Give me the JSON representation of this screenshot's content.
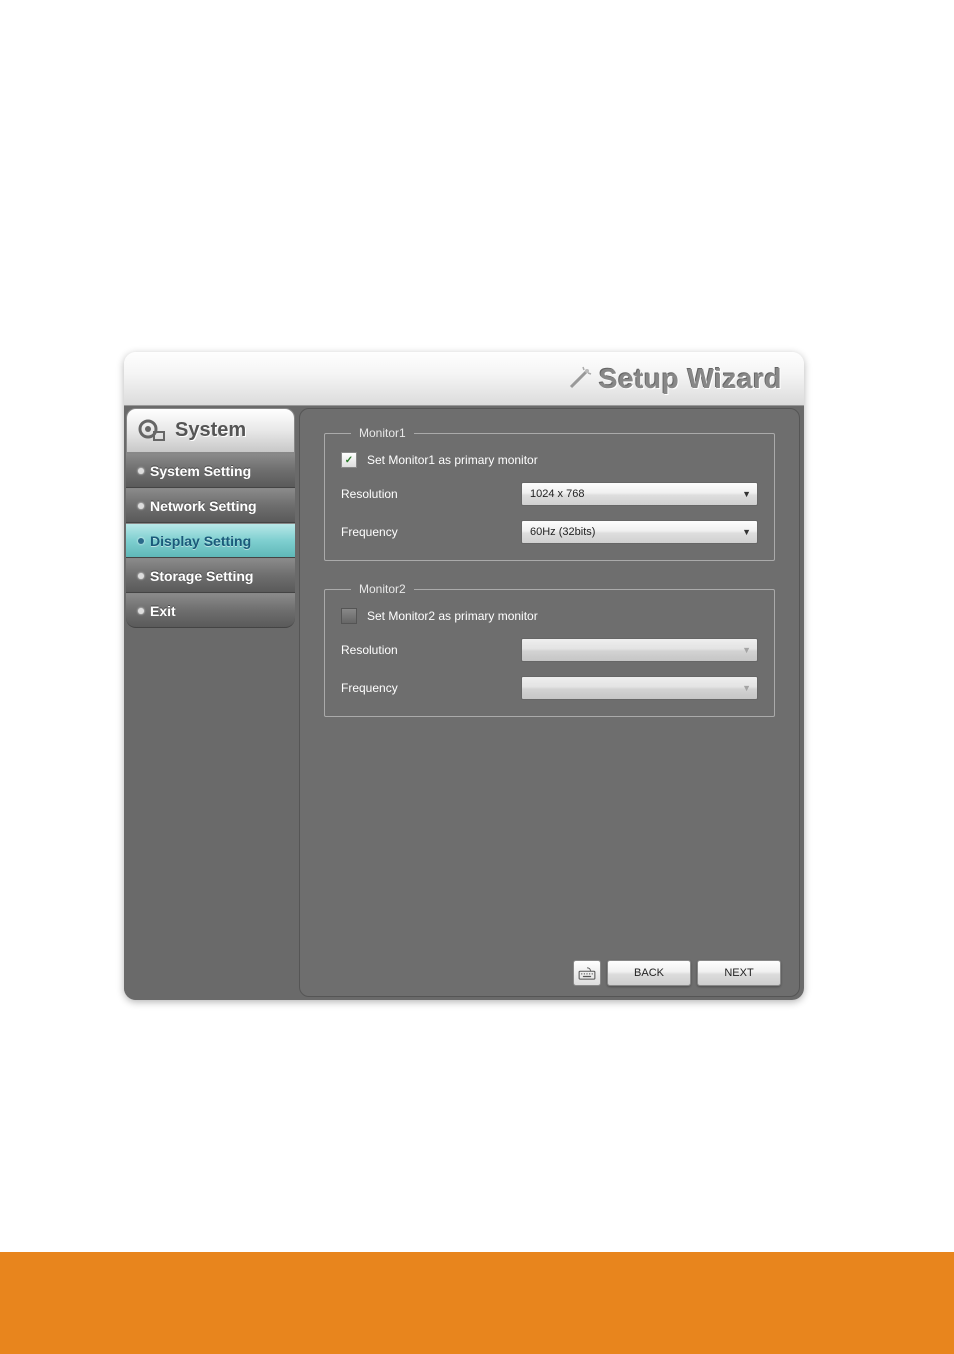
{
  "window": {
    "title": "Setup Wizard"
  },
  "sidebar": {
    "header": "System",
    "items": [
      {
        "label": "System Setting"
      },
      {
        "label": "Network Setting"
      },
      {
        "label": "Display Setting"
      },
      {
        "label": "Storage Setting"
      },
      {
        "label": "Exit"
      }
    ]
  },
  "monitor1": {
    "legend": "Monitor1",
    "primary_label": "Set Monitor1  as primary monitor",
    "primary_checked": true,
    "resolution_label": "Resolution",
    "resolution_value": "1024 x 768",
    "frequency_label": "Frequency",
    "frequency_value": "60Hz (32bits)"
  },
  "monitor2": {
    "legend": "Monitor2",
    "primary_label": "Set Monitor2  as primary monitor",
    "primary_checked": false,
    "resolution_label": "Resolution",
    "resolution_value": "",
    "frequency_label": "Frequency",
    "frequency_value": ""
  },
  "buttons": {
    "back": "BACK",
    "next": "NEXT"
  }
}
